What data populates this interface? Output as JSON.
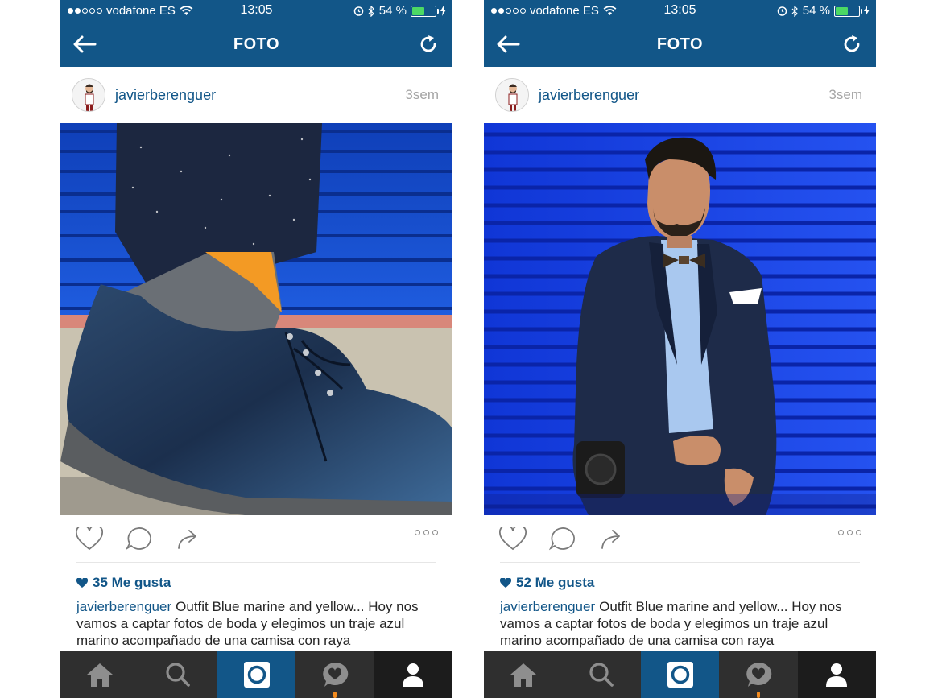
{
  "status_bar": {
    "carrier": "vodafone ES",
    "time": "13:05",
    "battery_percent": "54 %",
    "battery_level": 0.54
  },
  "nav": {
    "title": "FOTO"
  },
  "posts": [
    {
      "username": "javierberenguer",
      "time_ago": "3sem",
      "likes": "35 Me gusta",
      "caption_user": "javierberenguer",
      "caption_text": "Outfit Blue marine and yellow... Hoy nos vamos a captar fotos de boda y elegimos un traje azul marino acompañado de una camisa con raya"
    },
    {
      "username": "javierberenguer",
      "time_ago": "3sem",
      "likes": "52 Me gusta",
      "caption_user": "javierberenguer",
      "caption_text": "Outfit Blue marine and yellow... Hoy nos vamos a captar fotos de boda y elegimos un traje azul marino acompañado de una camisa con raya"
    }
  ],
  "colors": {
    "brand": "#125688",
    "tabbar": "#2f2f2f",
    "notification": "#f28b1f"
  },
  "icons": {
    "back": "arrow-left-icon",
    "refresh": "refresh-icon",
    "like": "heart-icon",
    "comment": "comment-icon",
    "share": "share-icon",
    "more": "more-icon",
    "home": "home-icon",
    "search": "search-icon",
    "camera": "camera-icon",
    "activity": "activity-icon",
    "profile": "profile-icon"
  }
}
